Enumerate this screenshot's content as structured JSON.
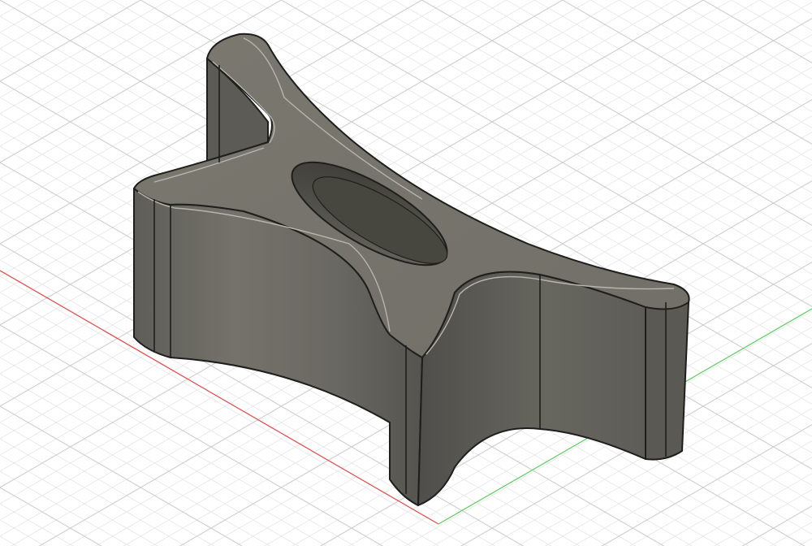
{
  "viewport": {
    "background_color": "#ffffff",
    "grid_minor_color": "#e3e3e3",
    "grid_major_color": "#c9c9c9",
    "axis_x_color": "#e03c3c",
    "axis_y_color": "#3cc43c"
  },
  "model": {
    "body_color": "#6f6d66",
    "top_face_color": "#7b7970",
    "edge_color": "#1e1e1c",
    "highlight_color": "#b8b6ae",
    "hole_color": "#4a4944"
  }
}
